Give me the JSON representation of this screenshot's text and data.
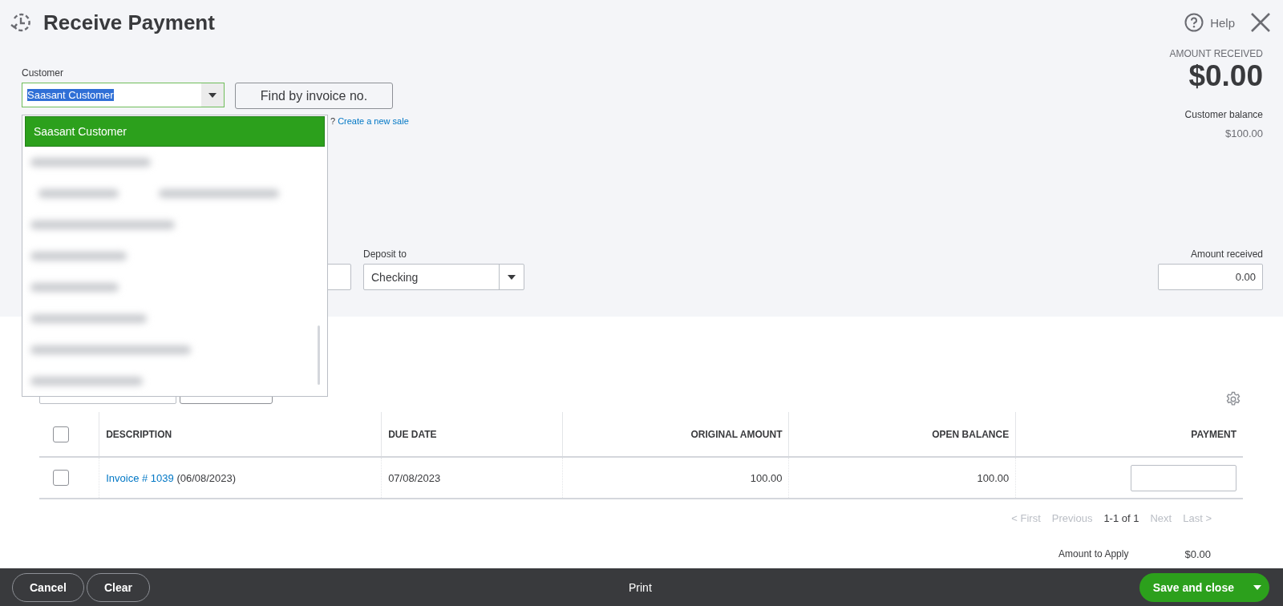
{
  "header": {
    "title": "Receive Payment",
    "help": "Help"
  },
  "customer": {
    "label": "Customer",
    "value": "Saasant Customer",
    "value_selected": true,
    "find_button": "Find by invoice no.",
    "hint_tail": "?",
    "hint_link": "Create a new sale"
  },
  "dropdown": {
    "options": [
      {
        "kind": "text",
        "label": "Saasant Customer",
        "selected": true
      },
      {
        "kind": "blurred",
        "selected": false
      },
      {
        "kind": "blurred_pair",
        "selected": false
      },
      {
        "kind": "blurred",
        "selected": false
      },
      {
        "kind": "blurred",
        "selected": false
      },
      {
        "kind": "blurred",
        "selected": false
      },
      {
        "kind": "blurred",
        "selected": false
      },
      {
        "kind": "blurred",
        "selected": false
      },
      {
        "kind": "blurred",
        "selected": false
      }
    ]
  },
  "summary": {
    "amount_received_label": "AMOUNT RECEIVED",
    "amount_received": "$0.00",
    "balance_label": "Customer balance",
    "balance": "$100.00"
  },
  "deposit": {
    "label": "Deposit to",
    "value": "Checking"
  },
  "amount_field": {
    "label": "Amount received",
    "value": "0.00"
  },
  "table": {
    "select_all_checked": false,
    "columns": [
      {
        "label": "DESCRIPTION"
      },
      {
        "label": "DUE DATE"
      },
      {
        "label": "ORIGINAL AMOUNT"
      },
      {
        "label": "OPEN BALANCE"
      },
      {
        "label": "PAYMENT"
      }
    ],
    "rows": [
      {
        "checked": false,
        "link": "Invoice # 1039",
        "description": "(06/08/2023)",
        "due_date": "07/08/2023",
        "original_amount": "100.00",
        "open_balance": "100.00"
      }
    ]
  },
  "pagination": {
    "first": "< First",
    "previous": "Previous",
    "range": "1-1 of 1",
    "next": "Next",
    "last": "Last >"
  },
  "amount_to_apply": {
    "label": "Amount to Apply",
    "value": "$0.00"
  },
  "footer": {
    "cancel": "Cancel",
    "clear": "Clear",
    "print": "Print",
    "save": "Save and close"
  }
}
